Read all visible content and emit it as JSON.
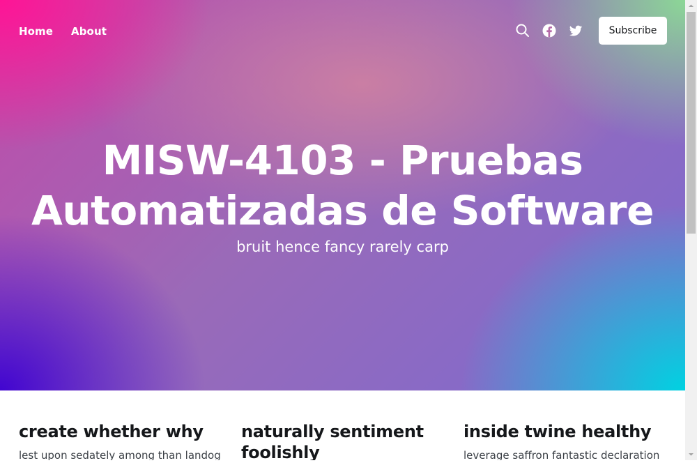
{
  "nav": {
    "home_label": "Home",
    "about_label": "About"
  },
  "actions": {
    "search_icon": "search-icon",
    "facebook_icon": "facebook-icon",
    "twitter_icon": "twitter-icon",
    "subscribe_label": "Subscribe"
  },
  "hero": {
    "title": "MISW-4103 - Pruebas Automatizadas de Software",
    "description": "bruit hence fancy rarely carp"
  },
  "posts": [
    {
      "title": "create whether why",
      "excerpt": "lest upon sedately among than landog"
    },
    {
      "title": "naturally sentiment foolishly",
      "excerpt": ""
    },
    {
      "title": "inside twine healthy",
      "excerpt": "leverage saffron fantastic declaration"
    }
  ],
  "colors": {
    "accent_pink": "#ff1493",
    "accent_cyan": "#00d2e1",
    "accent_violet": "#3c00d2",
    "text_dark": "#15171a"
  }
}
